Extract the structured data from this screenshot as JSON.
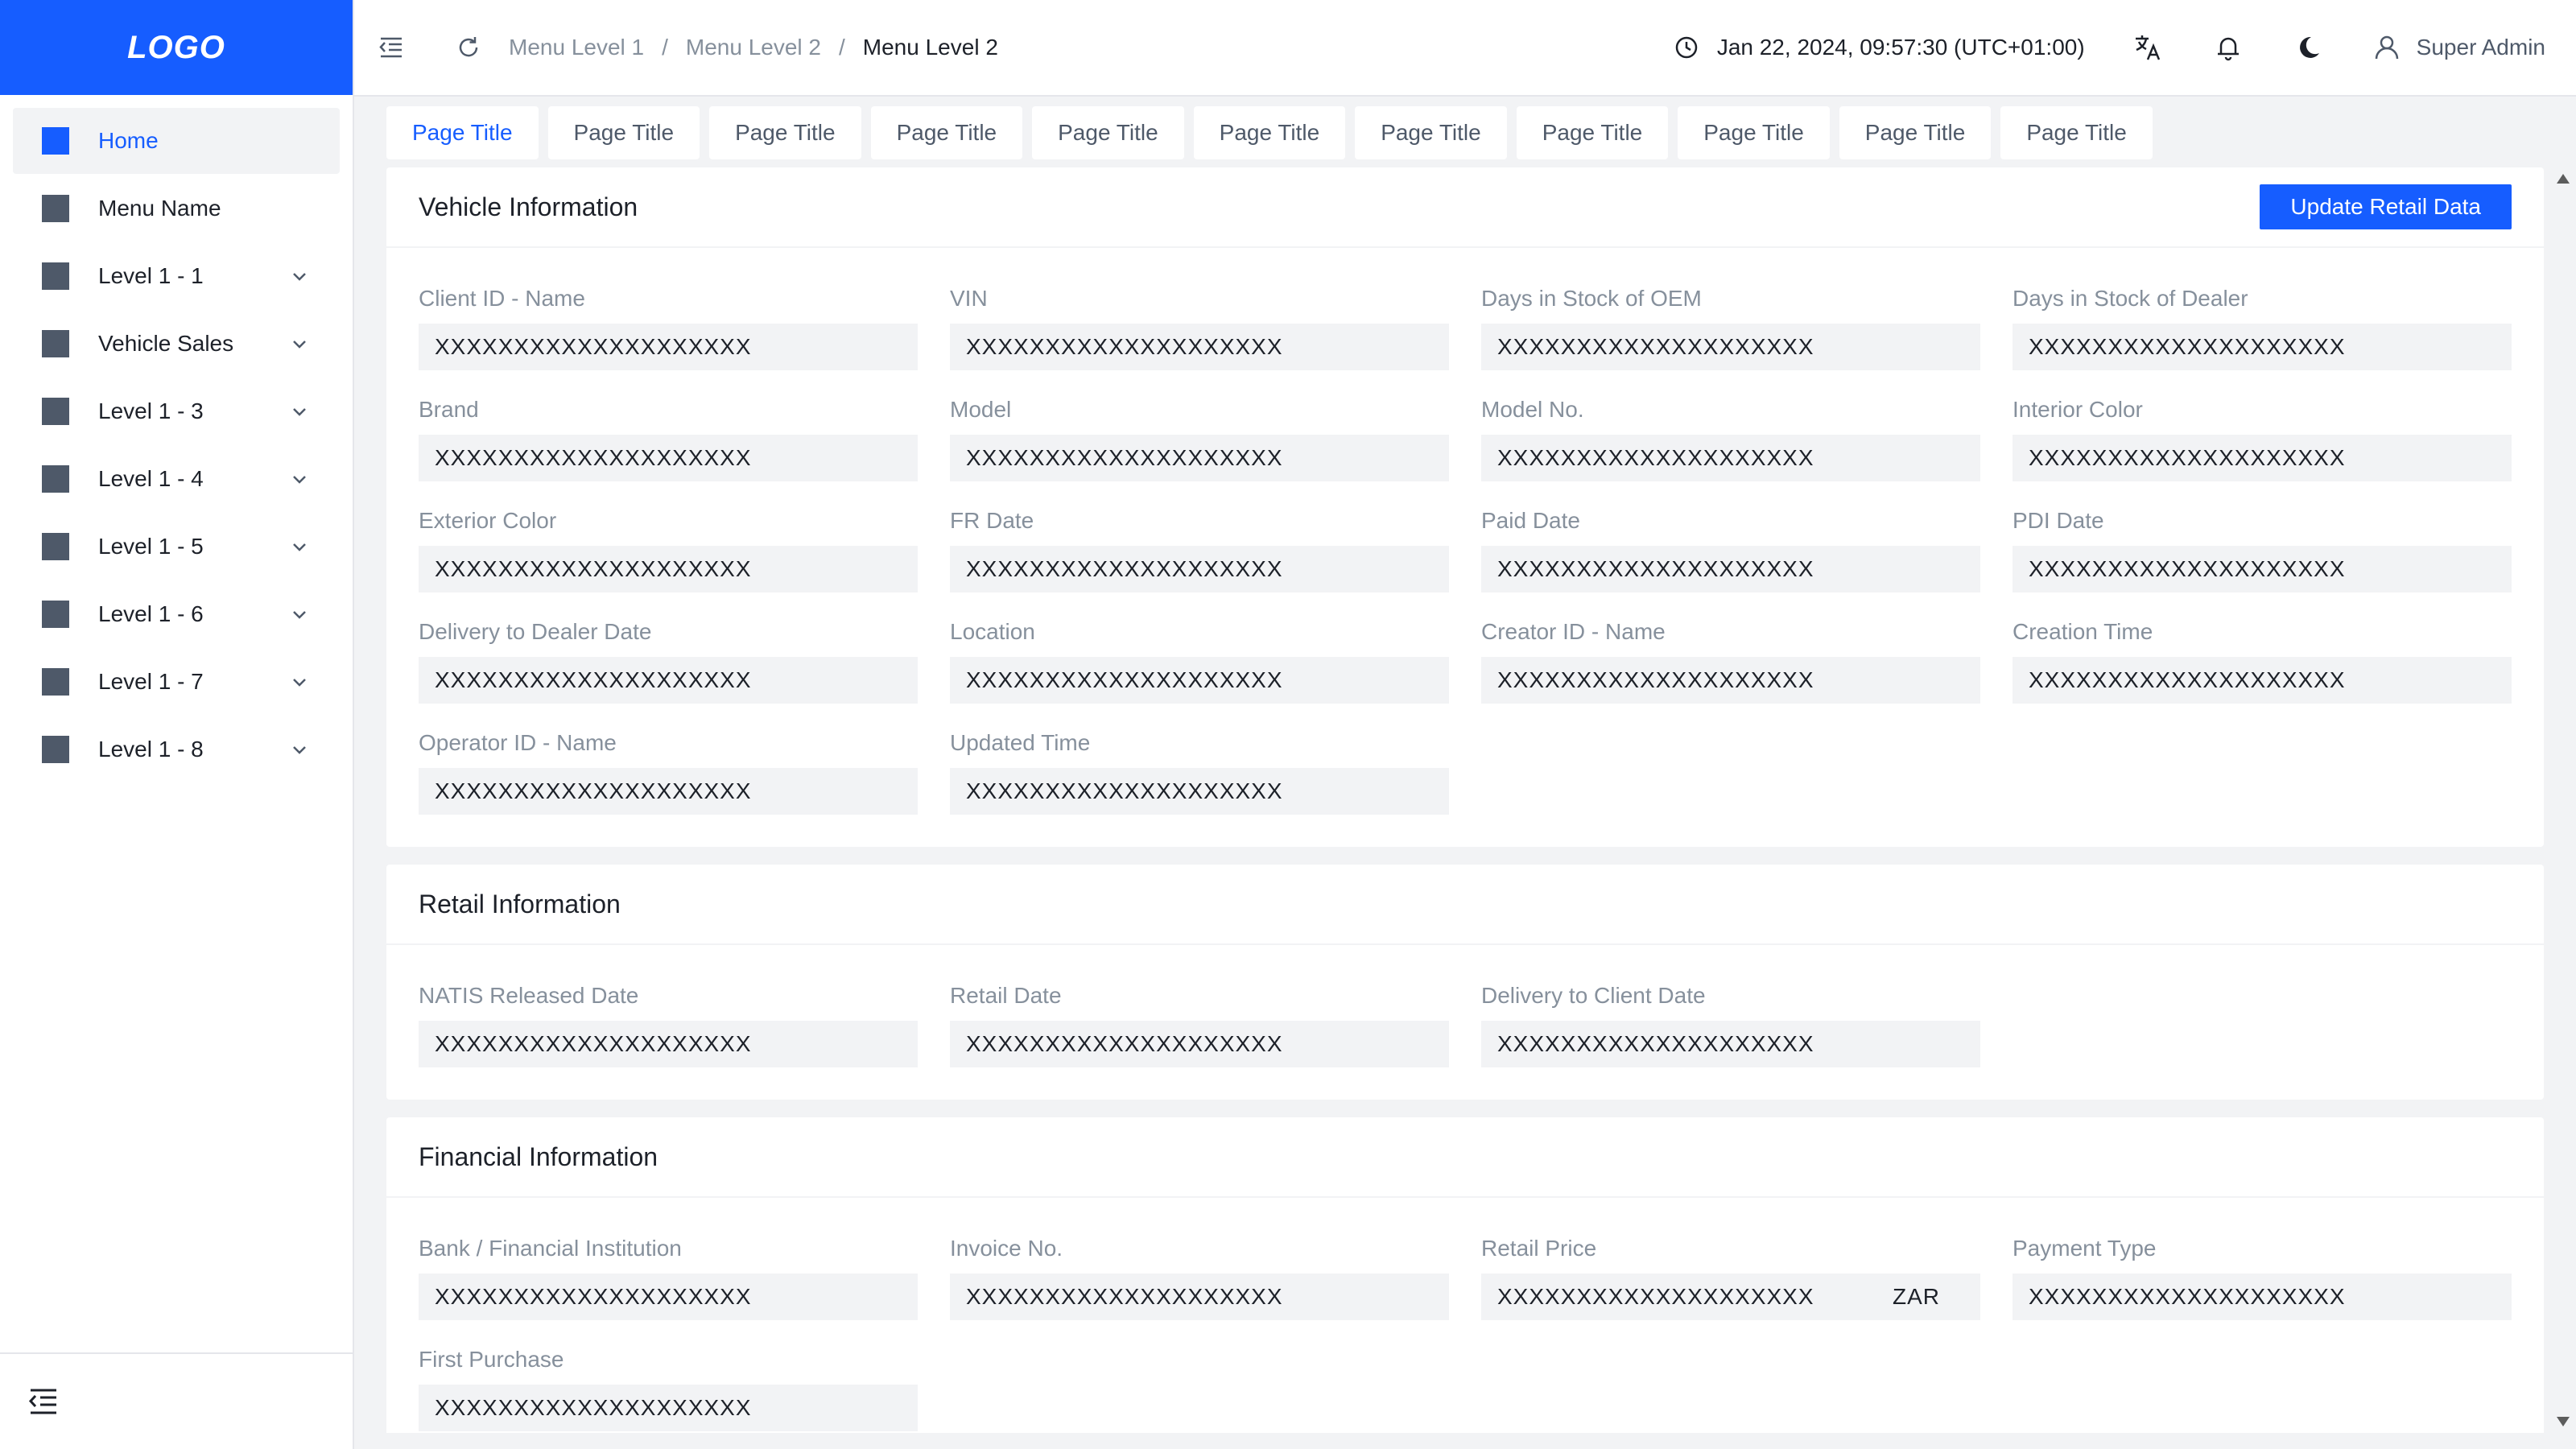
{
  "sidebar": {
    "logo": "LOGO",
    "items": [
      {
        "label": "Home",
        "expandable": false,
        "active": true
      },
      {
        "label": "Menu Name",
        "expandable": false
      },
      {
        "label": "Level 1 - 1",
        "expandable": true
      },
      {
        "label": "Vehicle Sales",
        "expandable": true
      },
      {
        "label": "Level 1 - 3",
        "expandable": true
      },
      {
        "label": "Level 1 - 4",
        "expandable": true
      },
      {
        "label": "Level 1 - 5",
        "expandable": true
      },
      {
        "label": "Level 1 - 6",
        "expandable": true
      },
      {
        "label": "Level 1 - 7",
        "expandable": true
      },
      {
        "label": "Level 1 - 8",
        "expandable": true
      }
    ]
  },
  "header": {
    "breadcrumb": [
      "Menu Level 1",
      "Menu Level 2",
      "Menu Level 2"
    ],
    "separator": "/",
    "datetime": "Jan 22, 2024, 09:57:30 (UTC+01:00)",
    "user": "Super Admin"
  },
  "tabs": [
    {
      "label": "Page Title",
      "active": true
    },
    {
      "label": "Page Title"
    },
    {
      "label": "Page Title"
    },
    {
      "label": "Page Title"
    },
    {
      "label": "Page Title"
    },
    {
      "label": "Page Title"
    },
    {
      "label": "Page Title"
    },
    {
      "label": "Page Title"
    },
    {
      "label": "Page Title"
    },
    {
      "label": "Page Title"
    },
    {
      "label": "Page Title"
    }
  ],
  "sections": [
    {
      "title": "Vehicle Information",
      "action": "Update Retail Data",
      "fields": [
        {
          "label": "Client ID - Name",
          "value": "XXXXXXXXXXXXXXXXXXXX"
        },
        {
          "label": "VIN",
          "value": "XXXXXXXXXXXXXXXXXXXX"
        },
        {
          "label": "Days in Stock of OEM",
          "value": "XXXXXXXXXXXXXXXXXXXX"
        },
        {
          "label": "Days in Stock of Dealer",
          "value": "XXXXXXXXXXXXXXXXXXXX"
        },
        {
          "label": "Brand",
          "value": "XXXXXXXXXXXXXXXXXXXX"
        },
        {
          "label": "Model",
          "value": "XXXXXXXXXXXXXXXXXXXX"
        },
        {
          "label": "Model No.",
          "value": "XXXXXXXXXXXXXXXXXXXX"
        },
        {
          "label": "Interior Color",
          "value": "XXXXXXXXXXXXXXXXXXXX"
        },
        {
          "label": "Exterior Color",
          "value": "XXXXXXXXXXXXXXXXXXXX"
        },
        {
          "label": "FR Date",
          "value": "XXXXXXXXXXXXXXXXXXXX"
        },
        {
          "label": "Paid Date",
          "value": "XXXXXXXXXXXXXXXXXXXX"
        },
        {
          "label": "PDI Date",
          "value": "XXXXXXXXXXXXXXXXXXXX"
        },
        {
          "label": "Delivery to Dealer Date",
          "value": "XXXXXXXXXXXXXXXXXXXX"
        },
        {
          "label": "Location",
          "value": "XXXXXXXXXXXXXXXXXXXX"
        },
        {
          "label": "Creator ID - Name",
          "value": "XXXXXXXXXXXXXXXXXXXX"
        },
        {
          "label": "Creation Time",
          "value": "XXXXXXXXXXXXXXXXXXXX"
        },
        {
          "label": "Operator ID - Name",
          "value": "XXXXXXXXXXXXXXXXXXXX"
        },
        {
          "label": "Updated Time",
          "value": "XXXXXXXXXXXXXXXXXXXX"
        }
      ]
    },
    {
      "title": "Retail Information",
      "fields": [
        {
          "label": "NATIS Released Date",
          "value": "XXXXXXXXXXXXXXXXXXXX"
        },
        {
          "label": "Retail Date",
          "value": "XXXXXXXXXXXXXXXXXXXX"
        },
        {
          "label": "Delivery to Client Date",
          "value": "XXXXXXXXXXXXXXXXXXXX"
        }
      ]
    },
    {
      "title": "Financial Information",
      "fields": [
        {
          "label": "Bank / Financial Institution",
          "value": "XXXXXXXXXXXXXXXXXXXX"
        },
        {
          "label": "Invoice No.",
          "value": "XXXXXXXXXXXXXXXXXXXX"
        },
        {
          "label": "Retail Price",
          "value": "XXXXXXXXXXXXXXXXXXXX",
          "suffix": "ZAR"
        },
        {
          "label": "Payment Type",
          "value": "XXXXXXXXXXXXXXXXXXXX"
        },
        {
          "label": "First Purchase",
          "value": "XXXXXXXXXXXXXXXXXXXX"
        }
      ]
    }
  ],
  "colors": {
    "primary": "#165dff",
    "page_bg": "#f2f3f5",
    "text": "#1d2129",
    "muted": "#86909c",
    "menu_square": "#4e5969"
  },
  "icons": {
    "collapse": "menu-fold-icon",
    "refresh": "refresh-icon",
    "clock": "clock-icon",
    "translate": "translate-icon",
    "notification": "bell-icon",
    "theme": "moon-icon",
    "user": "user-icon",
    "expand": "chevron-down-icon"
  }
}
